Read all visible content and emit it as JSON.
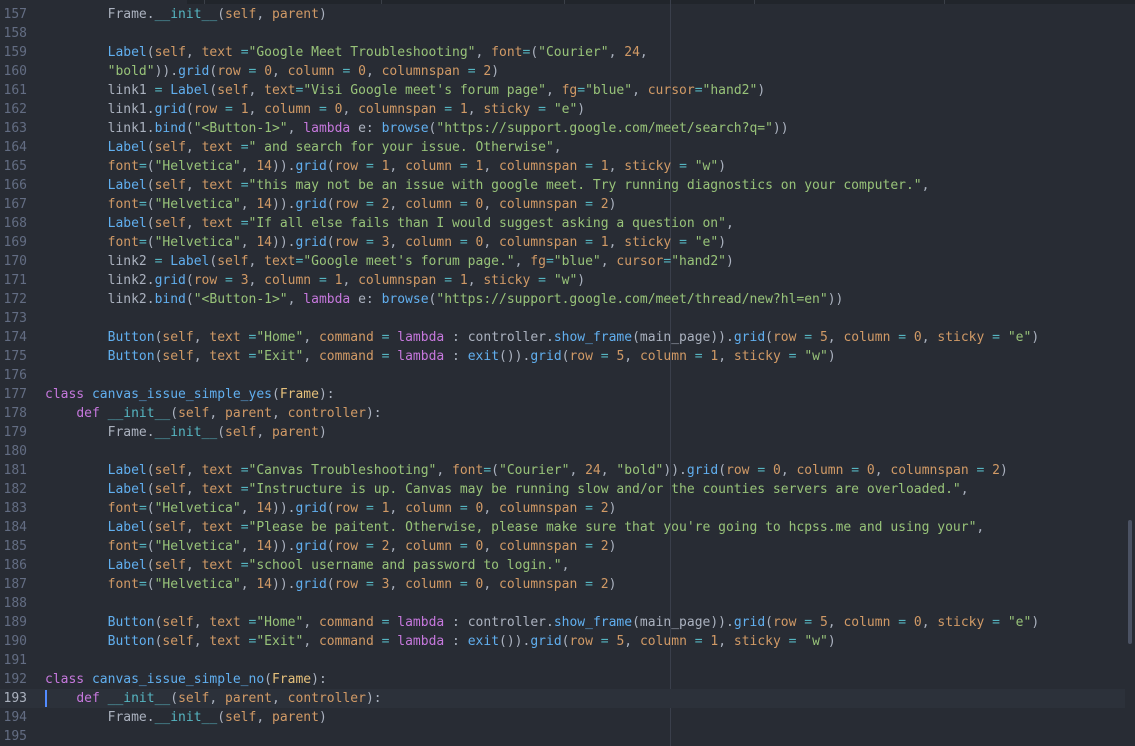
{
  "editor": {
    "cursor_line": 193,
    "lines": [
      {
        "n": "157",
        "code": "        Frame.__init__(self, parent)"
      },
      {
        "n": "158",
        "code": ""
      },
      {
        "n": "159",
        "code": "        Label(self, text =\"Google Meet Troubleshooting\", font=(\"Courier\", 24,"
      },
      {
        "n": "160",
        "code": "        \"bold\")).grid(row = 0, column = 0, columnspan = 2)"
      },
      {
        "n": "161",
        "code": "        link1 = Label(self, text=\"Visi Google meet's forum page\", fg=\"blue\", cursor=\"hand2\")"
      },
      {
        "n": "162",
        "code": "        link1.grid(row = 1, column = 0, columnspan = 1, sticky = \"e\")"
      },
      {
        "n": "163",
        "code": "        link1.bind(\"<Button-1>\", lambda e: browse(\"https://support.google.com/meet/search?q=\"))"
      },
      {
        "n": "164",
        "code": "        Label(self, text =\" and search for your issue. Otherwise\","
      },
      {
        "n": "165",
        "code": "        font=(\"Helvetica\", 14)).grid(row = 1, column = 1, columnspan = 1, sticky = \"w\")"
      },
      {
        "n": "166",
        "code": "        Label(self, text =\"this may not be an issue with google meet. Try running diagnostics on your computer.\","
      },
      {
        "n": "167",
        "code": "        font=(\"Helvetica\", 14)).grid(row = 2, column = 0, columnspan = 2)"
      },
      {
        "n": "168",
        "code": "        Label(self, text =\"If all else fails than I would suggest asking a question on\","
      },
      {
        "n": "169",
        "code": "        font=(\"Helvetica\", 14)).grid(row = 3, column = 0, columnspan = 1, sticky = \"e\")"
      },
      {
        "n": "170",
        "code": "        link2 = Label(self, text=\"Google meet's forum page.\", fg=\"blue\", cursor=\"hand2\")"
      },
      {
        "n": "171",
        "code": "        link2.grid(row = 3, column = 1, columnspan = 1, sticky = \"w\")"
      },
      {
        "n": "172",
        "code": "        link2.bind(\"<Button-1>\", lambda e: browse(\"https://support.google.com/meet/thread/new?hl=en\"))"
      },
      {
        "n": "173",
        "code": ""
      },
      {
        "n": "174",
        "code": "        Button(self, text =\"Home\", command = lambda : controller.show_frame(main_page)).grid(row = 5, column = 0, sticky = \"e\")"
      },
      {
        "n": "175",
        "code": "        Button(self, text =\"Exit\", command = lambda : exit()).grid(row = 5, column = 1, sticky = \"w\")"
      },
      {
        "n": "176",
        "code": ""
      },
      {
        "n": "177",
        "code": "class canvas_issue_simple_yes(Frame):"
      },
      {
        "n": "178",
        "code": "    def __init__(self, parent, controller):"
      },
      {
        "n": "179",
        "code": "        Frame.__init__(self, parent)"
      },
      {
        "n": "180",
        "code": ""
      },
      {
        "n": "181",
        "code": "        Label(self, text =\"Canvas Troubleshooting\", font=(\"Courier\", 24, \"bold\")).grid(row = 0, column = 0, columnspan = 2)"
      },
      {
        "n": "182",
        "code": "        Label(self, text =\"Instructure is up. Canvas may be running slow and/or the counties servers are overloaded.\","
      },
      {
        "n": "183",
        "code": "        font=(\"Helvetica\", 14)).grid(row = 1, column = 0, columnspan = 2)"
      },
      {
        "n": "184",
        "code": "        Label(self, text =\"Please be paitent. Otherwise, please make sure that you're going to hcpss.me and using your\","
      },
      {
        "n": "185",
        "code": "        font=(\"Helvetica\", 14)).grid(row = 2, column = 0, columnspan = 2)"
      },
      {
        "n": "186",
        "code": "        Label(self, text =\"school username and password to login.\","
      },
      {
        "n": "187",
        "code": "        font=(\"Helvetica\", 14)).grid(row = 3, column = 0, columnspan = 2)"
      },
      {
        "n": "188",
        "code": ""
      },
      {
        "n": "189",
        "code": "        Button(self, text =\"Home\", command = lambda : controller.show_frame(main_page)).grid(row = 5, column = 0, sticky = \"e\")"
      },
      {
        "n": "190",
        "code": "        Button(self, text =\"Exit\", command = lambda : exit()).grid(row = 5, column = 1, sticky = \"w\")"
      },
      {
        "n": "191",
        "code": ""
      },
      {
        "n": "192",
        "code": "class canvas_issue_simple_no(Frame):"
      },
      {
        "n": "193",
        "code": "    def __init__(self, parent, controller):"
      },
      {
        "n": "194",
        "code": "        Frame.__init__(self, parent)"
      },
      {
        "n": "195",
        "code": ""
      }
    ]
  }
}
